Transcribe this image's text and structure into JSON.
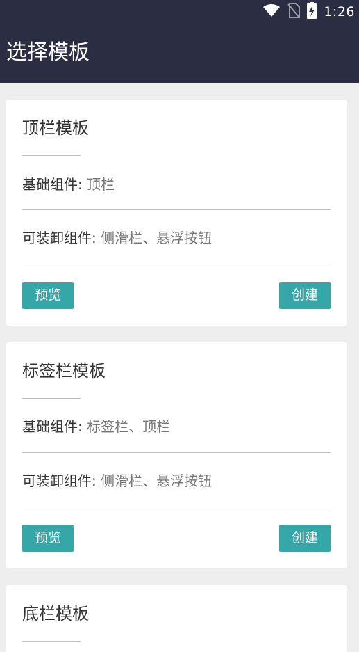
{
  "status_bar": {
    "time": "1:26",
    "icons": [
      "wifi-icon",
      "no-sim-icon",
      "battery-charging-icon"
    ]
  },
  "app_bar": {
    "title": "选择模板"
  },
  "colors": {
    "primary_dark": "#2b2d42",
    "accent": "#36a7a9",
    "background": "#eeeeee"
  },
  "cards": [
    {
      "title": "顶栏模板",
      "base_label": "基础组件:",
      "base_value": "顶栏",
      "optional_label": "可装卸组件:",
      "optional_value": "侧滑栏、悬浮按钮",
      "preview_label": "预览",
      "create_label": "创建"
    },
    {
      "title": "标签栏模板",
      "base_label": "基础组件:",
      "base_value": "标签栏、顶栏",
      "optional_label": "可装卸组件:",
      "optional_value": "侧滑栏、悬浮按钮",
      "preview_label": "预览",
      "create_label": "创建"
    },
    {
      "title": "底栏模板"
    }
  ]
}
